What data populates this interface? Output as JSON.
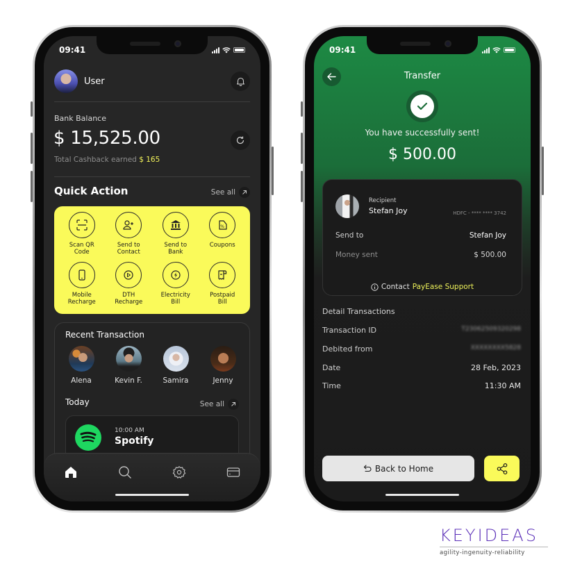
{
  "status_bar": {
    "time": "09:41"
  },
  "home": {
    "user_name": "User",
    "balance_label": "Bank Balance",
    "balance_amount": "$ 15,525.00",
    "cashback_label": "Total Cashback earned",
    "cashback_amount": "$ 165",
    "quick_action_title": "Quick Action",
    "see_all": "See all",
    "quick_actions": [
      {
        "label_line1": "Scan QR",
        "label_line2": "Code",
        "icon": "scan-qr-icon"
      },
      {
        "label_line1": "Send to",
        "label_line2": "Contact",
        "icon": "add-contact-icon"
      },
      {
        "label_line1": "Send to",
        "label_line2": "Bank",
        "icon": "bank-icon"
      },
      {
        "label_line1": "Coupons",
        "label_line2": "",
        "icon": "coupon-icon"
      },
      {
        "label_line1": "Mobile",
        "label_line2": "Recharge",
        "icon": "mobile-icon"
      },
      {
        "label_line1": "DTH",
        "label_line2": "Recharge",
        "icon": "play-icon"
      },
      {
        "label_line1": "Electricity",
        "label_line2": "Bill",
        "icon": "lightning-icon"
      },
      {
        "label_line1": "Postpaid",
        "label_line2": "Bill",
        "icon": "bill-icon"
      }
    ],
    "recent_title": "Recent Transaction",
    "recent_contacts": [
      "Alena",
      "Kevin F.",
      "Samira",
      "Jenny"
    ],
    "today_label": "Today",
    "today_see_all": "See all",
    "transaction": {
      "time": "10:00 AM",
      "merchant": "Spotify"
    },
    "nav": [
      "home-icon",
      "search-icon",
      "settings-icon",
      "card-icon"
    ]
  },
  "transfer": {
    "title": "Transfer",
    "success_message": "You have successfully sent!",
    "amount": "$ 500.00",
    "recipient_label": "Recipient",
    "recipient_name": "Stefan Joy",
    "bank_account": "HDFC - **** **** 3742",
    "send_to_label": "Send to",
    "send_to_value": "Stefan Joy",
    "money_sent_label": "Money sent",
    "money_sent_value": "$ 500.00",
    "contact_prefix": "Contact",
    "contact_link": "PayEase Support",
    "detail_title": "Detail Transactions",
    "details": [
      {
        "label": "Transaction ID",
        "value": "T23062509320298"
      },
      {
        "label": "Debited from",
        "value": "XXXXXXXX5828"
      },
      {
        "label": "Date",
        "value": "28 Feb, 2023"
      },
      {
        "label": "Time",
        "value": "11:30 AM"
      }
    ],
    "back_home_label": "Back to Home"
  },
  "brand": {
    "name": "KEYIDEAS",
    "tagline": "agility-ingenuity-reliability"
  },
  "colors": {
    "accent_yellow": "#fafa5a",
    "success_green": "#1d8a44",
    "dark_bg": "#262626",
    "brand_purple": "#5b2fb8"
  }
}
